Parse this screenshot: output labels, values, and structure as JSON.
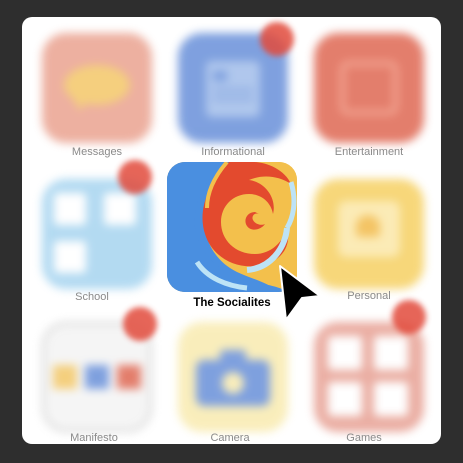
{
  "apps": [
    {
      "label": "Messages",
      "badge": false,
      "color": "#e38f7a"
    },
    {
      "label": "Informational",
      "badge": true,
      "color": "#3f6fc7"
    },
    {
      "label": "Entertainment",
      "badge": false,
      "color": "#d7533b"
    },
    {
      "label": "School",
      "badge": true,
      "color": "#93c9ea"
    },
    {
      "label": "The Socialites",
      "badge": false,
      "selected": true
    },
    {
      "label": "Personal",
      "badge": false,
      "color": "#f3c84e"
    },
    {
      "label": "Manifesto",
      "badge": true,
      "color": "#ececec"
    },
    {
      "label": "Camera",
      "badge": false,
      "color": "#f7e6a2"
    },
    {
      "label": "Games",
      "badge": true,
      "color": "#e08d7e"
    }
  ],
  "cursor_icon": "arrow-cursor-icon"
}
